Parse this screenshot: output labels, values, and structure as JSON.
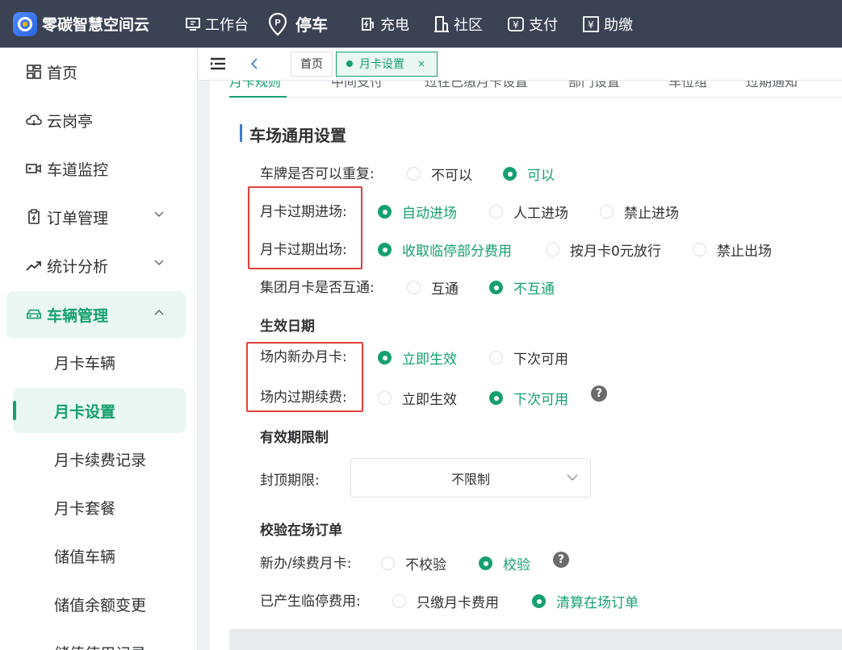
{
  "brand": {
    "name": "零碳智慧空间云"
  },
  "topnav": [
    {
      "label": "工作台",
      "icon": "monitor-icon"
    },
    {
      "label": "停车",
      "icon": "parking-pin-icon",
      "active": true
    },
    {
      "label": "充电",
      "icon": "charging-icon"
    },
    {
      "label": "社区",
      "icon": "building-icon"
    },
    {
      "label": "支付",
      "icon": "yen-icon"
    },
    {
      "label": "助缴",
      "icon": "yen-box-icon"
    }
  ],
  "sidebar": {
    "items": [
      {
        "label": "首页",
        "icon": "home-dashboard-icon"
      },
      {
        "label": "云岗亭",
        "icon": "cloud-icon"
      },
      {
        "label": "车道监控",
        "icon": "camera-icon"
      },
      {
        "label": "订单管理",
        "icon": "order-icon"
      },
      {
        "label": "统计分析",
        "icon": "trend-icon"
      },
      {
        "label": "车辆管理",
        "icon": "car-icon"
      }
    ],
    "subitems": [
      "月卡车辆",
      "月卡设置",
      "月卡续费记录",
      "月卡套餐",
      "储值车辆",
      "储值余额变更",
      "储值使用记录"
    ]
  },
  "tabs": {
    "home": "首页",
    "current": "月卡设置",
    "close": "×"
  },
  "subtabs": [
    "月卡规则",
    "中间支付",
    "过往已缴月卡设置",
    "部门设置",
    "车位组",
    "过期通知"
  ],
  "section": {
    "title": "车场通用设置",
    "plate_repeat": {
      "label": "车牌是否可以重复:",
      "options": [
        "不可以",
        "可以"
      ]
    },
    "expired_entry": {
      "label": "月卡过期进场:",
      "options": [
        "自动进场",
        "人工进场",
        "禁止进场"
      ]
    },
    "expired_exit": {
      "label": "月卡过期出场:",
      "options": [
        "收取临停部分费用",
        "按月卡0元放行",
        "禁止出场"
      ]
    },
    "group_share": {
      "label": "集团月卡是否互通:",
      "options": [
        "互通",
        "不互通"
      ]
    },
    "effective_heading": "生效日期",
    "new_card": {
      "label": "场内新办月卡:",
      "options": [
        "立即生效",
        "下次可用"
      ]
    },
    "expired_renew": {
      "label": "场内过期续费:",
      "options": [
        "立即生效",
        "下次可用"
      ]
    },
    "validity_heading": "有效期限制",
    "cap_limit": {
      "label": "封顶期限:",
      "value": "不限制"
    },
    "check_heading": "校验在场订单",
    "check_new": {
      "label": "新办/续费月卡:",
      "options": [
        "不校验",
        "校验"
      ]
    },
    "temp_fee": {
      "label": "已产生临停费用:",
      "options": [
        "只缴月卡费用",
        "清算在场订单"
      ]
    },
    "help_glyph": "?"
  },
  "colors": {
    "accent": "#15a06e",
    "topbar": "#3b4254",
    "highlight_box": "#e0403a"
  }
}
